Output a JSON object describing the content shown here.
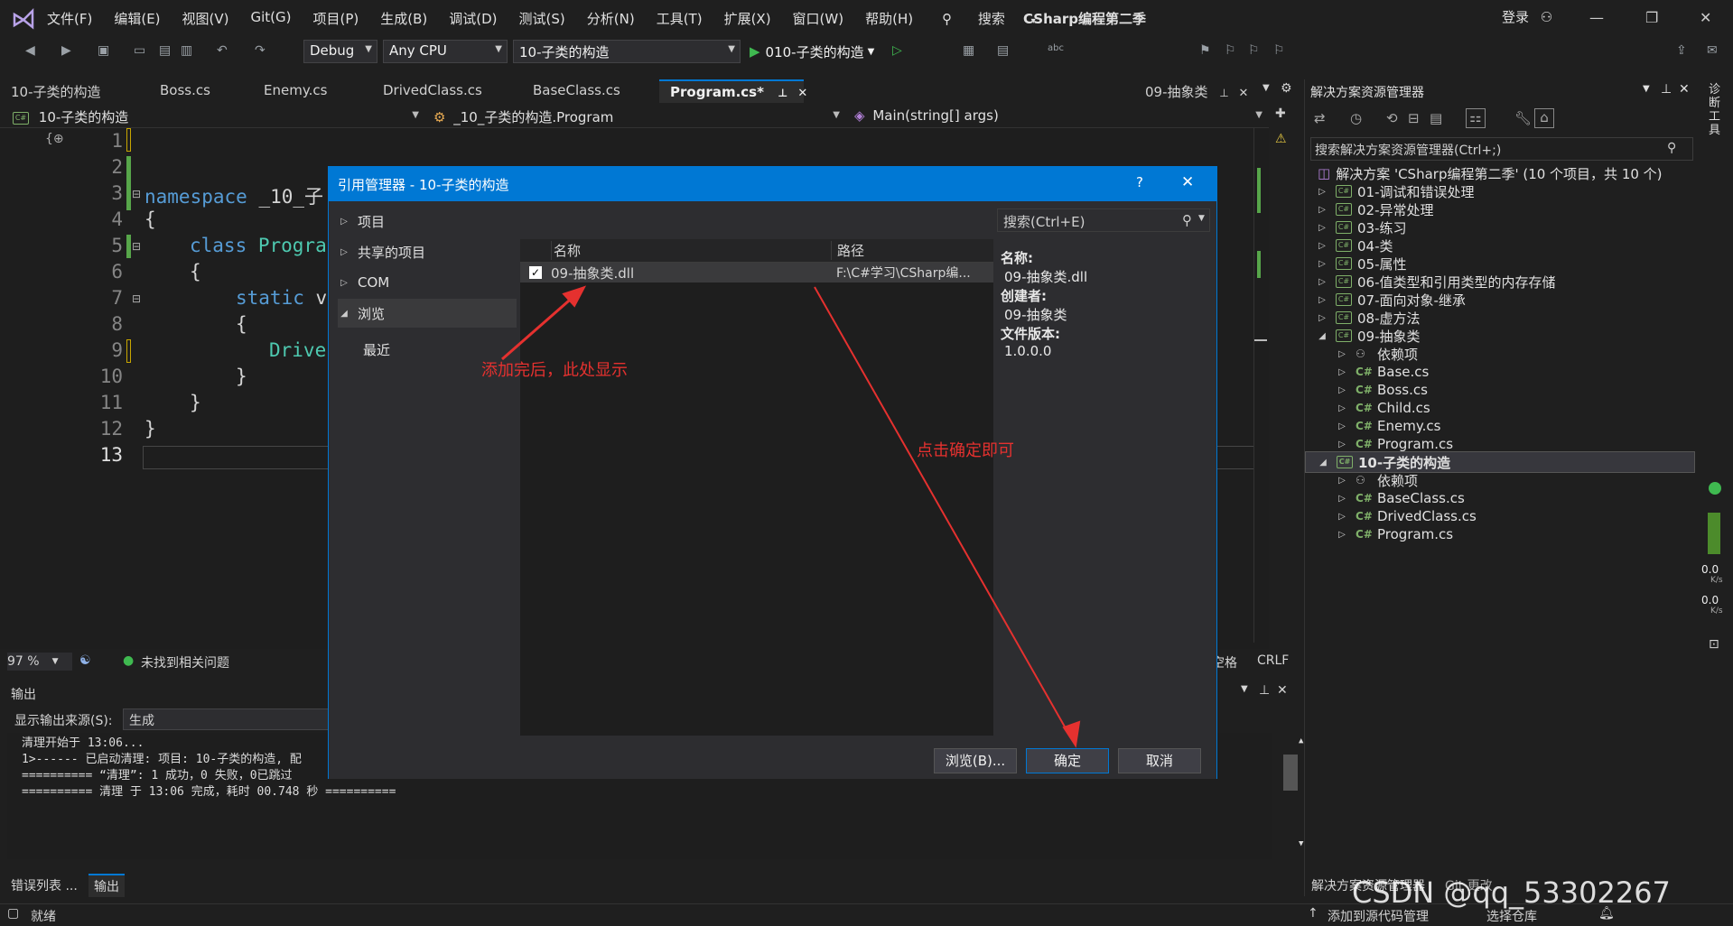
{
  "menubar": {
    "items": [
      "文件(F)",
      "编辑(E)",
      "视图(V)",
      "Git(G)",
      "项目(P)",
      "生成(B)",
      "调试(D)",
      "测试(S)",
      "分析(N)",
      "工具(T)",
      "扩展(X)",
      "窗口(W)",
      "帮助(H)"
    ],
    "search": "搜索",
    "title": "CSharp编程第二季",
    "login": "登录"
  },
  "toolbar": {
    "config": "Debug",
    "platform": "Any CPU",
    "project": "10-子类的构造",
    "run_target": "010-子类的构造"
  },
  "tabs": [
    {
      "label": "10-子类的构造",
      "active": false
    },
    {
      "label": "Boss.cs",
      "active": false
    },
    {
      "label": "Enemy.cs",
      "active": false
    },
    {
      "label": "DrivedClass.cs",
      "active": false
    },
    {
      "label": "BaseClass.cs",
      "active": false
    },
    {
      "label": "Program.cs*",
      "active": true
    }
  ],
  "right_tab": "09-抽象类",
  "navbar": {
    "project": "10-子类的构造",
    "class": "_10_子类的构造.Program",
    "member": "Main(string[] args)"
  },
  "editor": {
    "lines": [
      {
        "n": "1"
      },
      {
        "n": "2"
      },
      {
        "n": "3"
      },
      {
        "n": "4"
      },
      {
        "n": "5"
      },
      {
        "n": "6"
      },
      {
        "n": "7"
      },
      {
        "n": "8"
      },
      {
        "n": "9"
      },
      {
        "n": "10"
      },
      {
        "n": "11"
      },
      {
        "n": "12"
      },
      {
        "n": "13"
      }
    ],
    "code": {
      "l3_kw": "namespace",
      "l3_rest": " _10_子",
      "l4": "{",
      "l5_kw": "class",
      "l5_ty": " Progra",
      "l6": "{",
      "l7_kw": "static",
      "l7_rest": " v",
      "l8": "{",
      "l9_ty": "Drive",
      "l10": "}",
      "l11": "}",
      "l12": "}"
    }
  },
  "editor_status": {
    "zoom": "97 %",
    "issues": "未找到相关问题",
    "eol": "CRLF",
    "enc_partial": "空格"
  },
  "output": {
    "title": "输出",
    "source_label": "显示输出来源(S):",
    "source_value": "生成",
    "lines": [
      "清理开始于 13:06...",
      "1>------ 已启动清理: 项目: 10-子类的构造, 配",
      "========== “清理”: 1 成功，0 失败，0已跳过",
      "========== 清理 于 13:06 完成，耗时 00.748 秒 =========="
    ]
  },
  "bottom_tabs": [
    "错误列表 ...",
    "输出"
  ],
  "statusbar": {
    "ready": "就绪",
    "add_source": "添加到源代码管理",
    "select_repo": "选择仓库"
  },
  "solution_explorer": {
    "title": "解决方案资源管理器",
    "search_placeholder": "搜索解决方案资源管理器(Ctrl+;)",
    "solution": "解决方案 'CSharp编程第二季' (10 个项目，共 10 个)",
    "items": [
      {
        "label": "01-调试和错误处理",
        "level": 0,
        "kind": "project",
        "expanded": false
      },
      {
        "label": "02-异常处理",
        "level": 0,
        "kind": "project",
        "expanded": false
      },
      {
        "label": "03-练习",
        "level": 0,
        "kind": "project",
        "expanded": false
      },
      {
        "label": "04-类",
        "level": 0,
        "kind": "project",
        "expanded": false
      },
      {
        "label": "05-属性",
        "level": 0,
        "kind": "project",
        "expanded": false
      },
      {
        "label": "06-值类型和引用类型的内存存储",
        "level": 0,
        "kind": "project",
        "expanded": false
      },
      {
        "label": "07-面向对象-继承",
        "level": 0,
        "kind": "project",
        "expanded": false
      },
      {
        "label": "08-虚方法",
        "level": 0,
        "kind": "project",
        "expanded": false
      },
      {
        "label": "09-抽象类",
        "level": 0,
        "kind": "project",
        "expanded": true
      },
      {
        "label": "依赖项",
        "level": 1,
        "kind": "deps",
        "expanded": false
      },
      {
        "label": "Base.cs",
        "level": 1,
        "kind": "cs",
        "expanded": false
      },
      {
        "label": "Boss.cs",
        "level": 1,
        "kind": "cs",
        "expanded": false
      },
      {
        "label": "Child.cs",
        "level": 1,
        "kind": "cs",
        "expanded": false
      },
      {
        "label": "Enemy.cs",
        "level": 1,
        "kind": "cs",
        "expanded": false
      },
      {
        "label": "Program.cs",
        "level": 1,
        "kind": "cs",
        "expanded": false
      },
      {
        "label": "10-子类的构造",
        "level": 0,
        "kind": "project",
        "expanded": true,
        "selected": true
      },
      {
        "label": "依赖项",
        "level": 1,
        "kind": "deps",
        "expanded": false
      },
      {
        "label": "BaseClass.cs",
        "level": 1,
        "kind": "cs",
        "expanded": false
      },
      {
        "label": "DrivedClass.cs",
        "level": 1,
        "kind": "cs",
        "expanded": false
      },
      {
        "label": "Program.cs",
        "level": 1,
        "kind": "cs",
        "expanded": false
      }
    ],
    "bottom_tabs": [
      "解决方案资源管理器",
      "Git 更改"
    ]
  },
  "right_strip": {
    "label": "诊断工具",
    "rate1": "0.0",
    "unit1": "K/s",
    "rate2": "0.0",
    "unit2": "K/s"
  },
  "dialog": {
    "title": "引用管理器 - 10-子类的构造",
    "help": "?",
    "nav": [
      {
        "label": "项目",
        "expanded": false
      },
      {
        "label": "共享的项目",
        "expanded": false
      },
      {
        "label": "COM",
        "expanded": false
      },
      {
        "label": "浏览",
        "expanded": true,
        "selected": true
      }
    ],
    "nav_child": "最近",
    "search_placeholder": "搜索(Ctrl+E)",
    "columns": {
      "name": "名称",
      "path": "路径"
    },
    "rows": [
      {
        "checked": true,
        "name": "09-抽象类.dll",
        "path": "F:\\C#学习\\CSharp编..."
      }
    ],
    "info": {
      "name_label": "名称:",
      "name": "09-抽象类.dll",
      "creator_label": "创建者:",
      "creator": "09-抽象类",
      "version_label": "文件版本:",
      "version": "1.0.0.0"
    },
    "buttons": {
      "browse": "浏览(B)...",
      "ok": "确定",
      "cancel": "取消"
    }
  },
  "annotations": {
    "a1": "添加完后，此处显示",
    "a2": "点击确定即可"
  },
  "watermark": "CSDN @qq_53302267",
  "colors": {
    "accent": "#0078d4",
    "annotation": "#e5312f"
  }
}
